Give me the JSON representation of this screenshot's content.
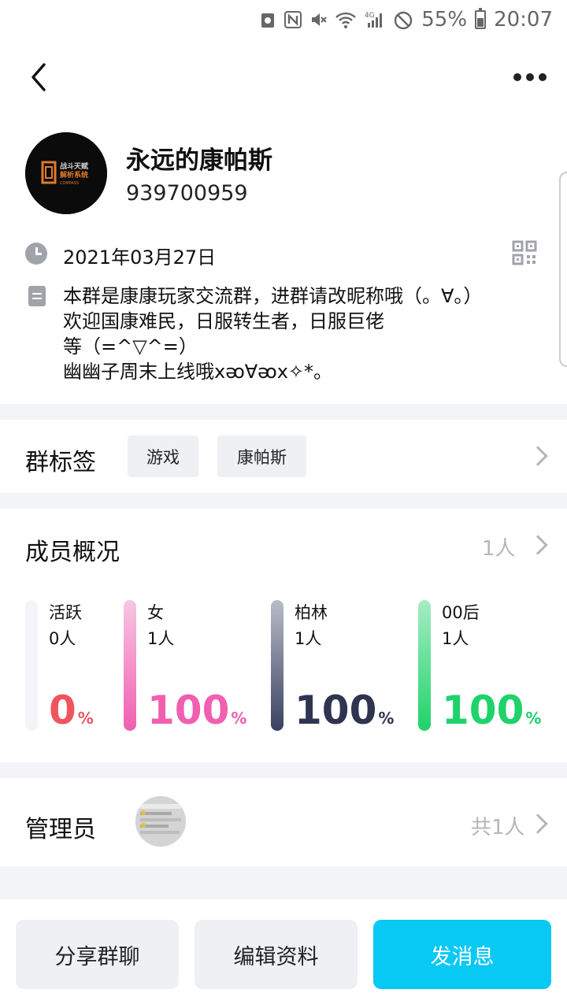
{
  "status_bar": {
    "battery": "55%",
    "time": "20:07",
    "network": "4G"
  },
  "header": {
    "back_icon": "chevron-left-icon",
    "more_icon": "more-dots-icon"
  },
  "group": {
    "name": "永远的康帕斯",
    "id": "939700959",
    "avatar_logo_lines": [
      "战斗天赋",
      "解析系统",
      "COMPASS"
    ],
    "created_date": "2021年03月27日",
    "description": "本群是康康玩家交流群，进群请改昵称哦（。∀。）\n欢迎国康难民，日服转生者，日服巨佬\n等（=^▽^=）\n幽幽子周末上线哦ⅹᴔ∀ᴔⅹ✧*。"
  },
  "tags_section": {
    "title": "群标签",
    "tags": [
      "游戏",
      "康帕斯"
    ]
  },
  "members_section": {
    "title": "成员概况",
    "total": "1人",
    "stats": [
      {
        "label": "活跃",
        "count": "0人",
        "percent": "0",
        "unit": "%",
        "value": 0,
        "color": "#f0545e",
        "bar_color": "#f3f4f7"
      },
      {
        "label": "女",
        "count": "1人",
        "percent": "100",
        "unit": "%",
        "value": 100,
        "color": "#f05fb0",
        "bar_color": "#f05fb0"
      },
      {
        "label": "柏林",
        "count": "1人",
        "percent": "100",
        "unit": "%",
        "value": 100,
        "color": "#2f3550",
        "bar_color": "#3a4060"
      },
      {
        "label": "00后",
        "count": "1人",
        "percent": "100",
        "unit": "%",
        "value": 100,
        "color": "#1ed36a",
        "bar_color": "#1ed36a"
      }
    ]
  },
  "admin_section": {
    "title": "管理员",
    "total": "共1人"
  },
  "actions": {
    "share": "分享群聊",
    "edit": "编辑资料",
    "message": "发消息"
  },
  "colors": {
    "accent": "#08c8f4",
    "divider": "#f3f4f7",
    "icon_gray": "#a0a3aa"
  }
}
